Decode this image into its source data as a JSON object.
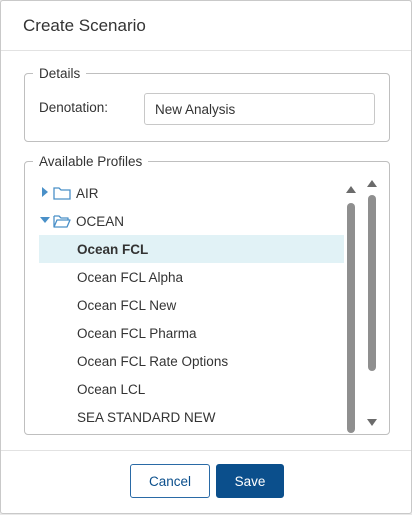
{
  "dialog": {
    "title": "Create Scenario"
  },
  "details": {
    "legend": "Details",
    "denotation_label": "Denotation:",
    "denotation_value": "New Analysis"
  },
  "profiles": {
    "legend": "Available Profiles",
    "folders": [
      {
        "label": "AIR",
        "expanded": false
      },
      {
        "label": "OCEAN",
        "expanded": true
      }
    ],
    "items": [
      {
        "label": "Ocean FCL",
        "selected": true
      },
      {
        "label": "Ocean FCL Alpha",
        "selected": false
      },
      {
        "label": "Ocean FCL New",
        "selected": false
      },
      {
        "label": "Ocean FCL Pharma",
        "selected": false
      },
      {
        "label": "Ocean FCL Rate Options",
        "selected": false
      },
      {
        "label": "Ocean LCL",
        "selected": false
      },
      {
        "label": "SEA STANDARD NEW",
        "selected": false
      }
    ]
  },
  "footer": {
    "cancel_label": "Cancel",
    "save_label": "Save"
  },
  "colors": {
    "accent": "#0b4f8c",
    "selection": "#e1f2f6",
    "folder_icon": "#4a90c8"
  },
  "icons": [
    "caret-right-icon",
    "caret-down-icon",
    "folder-icon",
    "folder-open-icon",
    "scroll-up-icon",
    "scroll-down-icon"
  ]
}
